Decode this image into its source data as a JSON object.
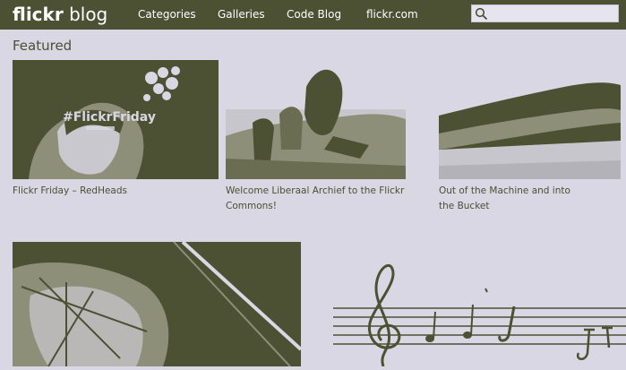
{
  "header": {
    "brand_main": "flickr",
    "brand_sub": "blog",
    "nav": [
      "Categories",
      "Galleries",
      "Code Blog",
      "flickr.com"
    ],
    "search": {
      "placeholder": "",
      "value": ""
    },
    "icons": {
      "search": "search-icon"
    }
  },
  "main": {
    "section_title": "Featured",
    "featured": [
      {
        "image_text": "#FlickrFriday",
        "caption": "Flickr Friday – RedHeads"
      },
      {
        "caption": "Welcome Liberaal Archief to the Flickr Commons!"
      },
      {
        "caption": "Out of the Machine and into the Bucket"
      }
    ]
  },
  "colors": {
    "olive": "#4c5133",
    "background": "#d9d7e3",
    "white": "#ffffff"
  }
}
